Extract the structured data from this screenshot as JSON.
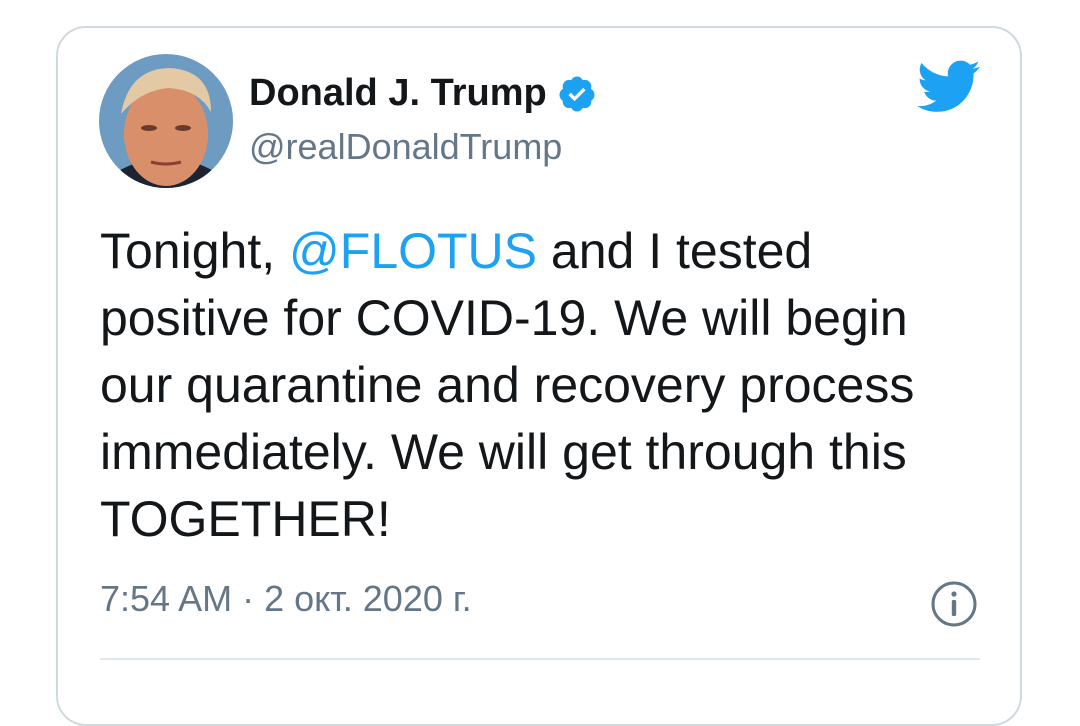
{
  "tweet": {
    "author": {
      "display_name": "Donald J. Trump",
      "handle": "@realDonaldTrump",
      "verified": true,
      "avatar_icon": "profile-photo"
    },
    "text_parts": [
      {
        "type": "text",
        "value": "Tonight, "
      },
      {
        "type": "mention",
        "value": "@FLOTUS"
      },
      {
        "type": "text",
        "value": " and I tested positive for COVID-19. We will begin our quarantine and recovery process immediately. We will get through this TOGETHER!"
      }
    ],
    "timestamp": "7:54 AM · 2 окт. 2020 г.",
    "icons": {
      "brand": "twitter-bird-icon",
      "verified": "verified-badge-icon",
      "info": "info-icon"
    },
    "colors": {
      "accent": "#1da1f2",
      "text": "#14171a",
      "secondary": "#657786",
      "border": "#cfd9de"
    }
  }
}
